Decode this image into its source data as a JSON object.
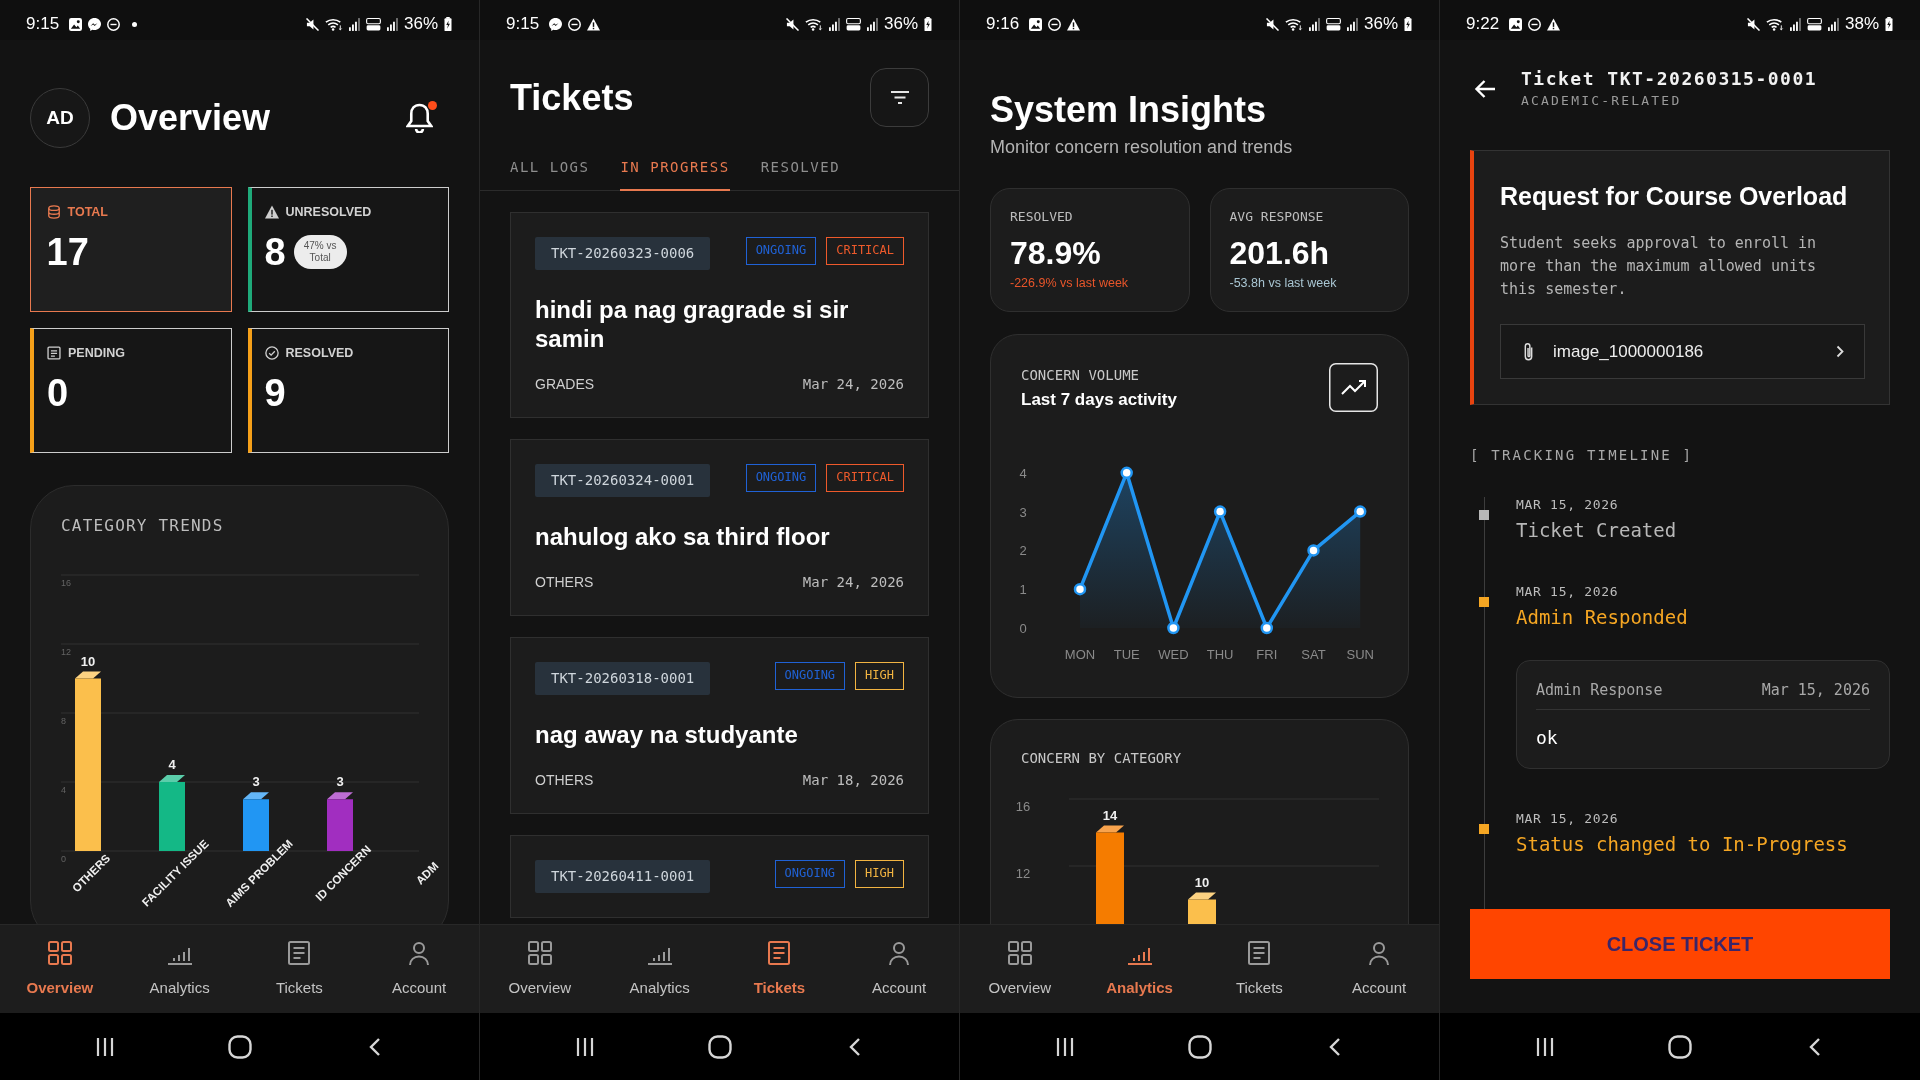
{
  "screens": [
    {
      "kind": "overview",
      "status_bar": {
        "time": "9:15",
        "notifications": [
          {
            "kind": "gallery"
          },
          {
            "kind": "messenger"
          },
          {
            "kind": "dnd"
          },
          {
            "kind": "dot"
          }
        ],
        "battery": "36%"
      },
      "header": {
        "avatar": "AD",
        "title": "Overview",
        "unread": true
      },
      "stats": [
        {
          "label": "TOTAL",
          "value": "17",
          "color": "#e8794f",
          "selected": true
        },
        {
          "label": "UNRESOLVED",
          "value": "8",
          "badge": "47% vs Total",
          "color": "#1faa7a",
          "selected": false
        },
        {
          "label": "PENDING",
          "value": "0",
          "color": "#f5a019",
          "selected": false
        },
        {
          "label": "RESOLVED",
          "value": "9",
          "color": "#f5a019",
          "selected": false
        }
      ],
      "category_trends": {
        "title": "CATEGORY TRENDS",
        "chart_data": {
          "type": "bar",
          "categories": [
            "OTHERS",
            "FACILITY ISSUE",
            "AIMS PROBLEM",
            "ID CONCERN",
            "ADM"
          ],
          "values": [
            10,
            4,
            3,
            3,
            null
          ],
          "colors": [
            "#fbbf4c",
            "#14b886",
            "#2196f3",
            "#a12ec0",
            null
          ],
          "ylim": [
            0,
            16
          ],
          "yticks": [
            0,
            4,
            8,
            12,
            16
          ],
          "grid": true,
          "data_labels": true
        }
      },
      "bottom_nav": [
        {
          "label": "Overview",
          "selected": true
        },
        {
          "label": "Analytics",
          "selected": false
        },
        {
          "label": "Tickets",
          "selected": false
        },
        {
          "label": "Account",
          "selected": false
        }
      ]
    },
    {
      "kind": "tickets",
      "status_bar": {
        "time": "9:15",
        "notifications": [
          {
            "kind": "messenger"
          },
          {
            "kind": "dnd"
          },
          {
            "kind": "alert"
          }
        ],
        "battery": "36%"
      },
      "title": "Tickets",
      "tabs": [
        {
          "label": "ALL LOGS",
          "selected": false
        },
        {
          "label": "IN PROGRESS",
          "selected": true
        },
        {
          "label": "RESOLVED",
          "selected": false
        }
      ],
      "tickets": [
        {
          "id": "TKT-20260323-0006",
          "badges": [
            {
              "label": "ONGOING",
              "color": "#2062d6"
            },
            {
              "label": "CRITICAL",
              "color": "#ee5a2b"
            }
          ],
          "title": "hindi pa nag gragrade si sir samin",
          "category": "GRADES",
          "date": "Mar 24, 2026"
        },
        {
          "id": "TKT-20260324-0001",
          "badges": [
            {
              "label": "ONGOING",
              "color": "#2062d6"
            },
            {
              "label": "CRITICAL",
              "color": "#ee5a2b"
            }
          ],
          "title": "nahulog ako sa third floor",
          "category": "OTHERS",
          "date": "Mar 24, 2026"
        },
        {
          "id": "TKT-20260318-0001",
          "badges": [
            {
              "label": "ONGOING",
              "color": "#2062d6"
            },
            {
              "label": "HIGH",
              "color": "#f2b441"
            }
          ],
          "title": "nag away na studyante",
          "category": "OTHERS",
          "date": "Mar 18, 2026"
        },
        {
          "id": "TKT-20260411-0001",
          "badges": [
            {
              "label": "ONGOING",
              "color": "#2062d6"
            },
            {
              "label": "HIGH",
              "color": "#f2b441"
            }
          ]
        }
      ],
      "bottom_nav": [
        {
          "label": "Overview",
          "selected": false
        },
        {
          "label": "Analytics",
          "selected": false
        },
        {
          "label": "Tickets",
          "selected": true
        },
        {
          "label": "Account",
          "selected": false
        }
      ]
    },
    {
      "kind": "insights",
      "status_bar": {
        "time": "9:16",
        "notifications": [
          {
            "kind": "gallery"
          },
          {
            "kind": "dnd"
          },
          {
            "kind": "alert"
          }
        ],
        "battery": "36%"
      },
      "title": "System Insights",
      "subtitle": "Monitor concern resolution and trends",
      "metrics": [
        {
          "label": "RESOLVED",
          "value": "78.9%",
          "change": "-226.9% vs last week",
          "color": "#e8552a"
        },
        {
          "label": "AVG RESPONSE",
          "value": "201.6h",
          "change": "-53.8h vs last week",
          "color": "#a9c6d3"
        }
      ],
      "volume": {
        "title": "CONCERN VOLUME",
        "subtitle": "Last 7 days activity",
        "chart_data": {
          "type": "area",
          "categories": [
            "MON",
            "TUE",
            "WED",
            "THU",
            "FRI",
            "SAT",
            "SUN"
          ],
          "values": [
            1,
            4,
            0,
            3,
            0,
            2,
            3
          ],
          "ylim": [
            0,
            4
          ],
          "yticks": [
            0,
            1,
            2,
            3,
            4
          ]
        }
      },
      "by_category": {
        "title": "CONCERN BY CATEGORY",
        "chart_data": {
          "type": "bar",
          "values": [
            14,
            10
          ],
          "colors": [
            "#f57c00",
            "#fbbf4c"
          ],
          "ylim": [
            0,
            16
          ],
          "yticks": [
            12,
            16
          ],
          "grid": true,
          "data_labels": true
        }
      },
      "bottom_nav": [
        {
          "label": "Overview",
          "selected": false
        },
        {
          "label": "Analytics",
          "selected": true
        },
        {
          "label": "Tickets",
          "selected": false
        },
        {
          "label": "Account",
          "selected": false
        }
      ]
    },
    {
      "kind": "ticket_detail",
      "status_bar": {
        "time": "9:22",
        "notifications": [
          {
            "kind": "gallery"
          },
          {
            "kind": "dnd"
          },
          {
            "kind": "alert"
          }
        ],
        "battery": "38%"
      },
      "title": "Ticket TKT-20260315-0001",
      "category": "ACADEMIC-RELATED",
      "request": {
        "title": "Request for Course Overload",
        "description": "Student seeks approval to enroll in more than the maximum allowed units this semester.",
        "attachment": "image_1000000186"
      },
      "timeline_title": "[ TRACKING TIMELINE ]",
      "timeline": [
        {
          "date": "MAR 15, 2026",
          "event": "Ticket Created",
          "color": "#b8b8b8"
        },
        {
          "date": "MAR 15, 2026",
          "event": "Admin Responded",
          "color": "#f5a623",
          "response": {
            "author": "Admin Response",
            "date": "Mar 15, 2026",
            "message": "ok"
          }
        },
        {
          "date": "MAR 15, 2026",
          "event": "Status changed to In-Progress",
          "color": "#f5a623"
        }
      ],
      "close_button": "CLOSE TICKET"
    }
  ]
}
